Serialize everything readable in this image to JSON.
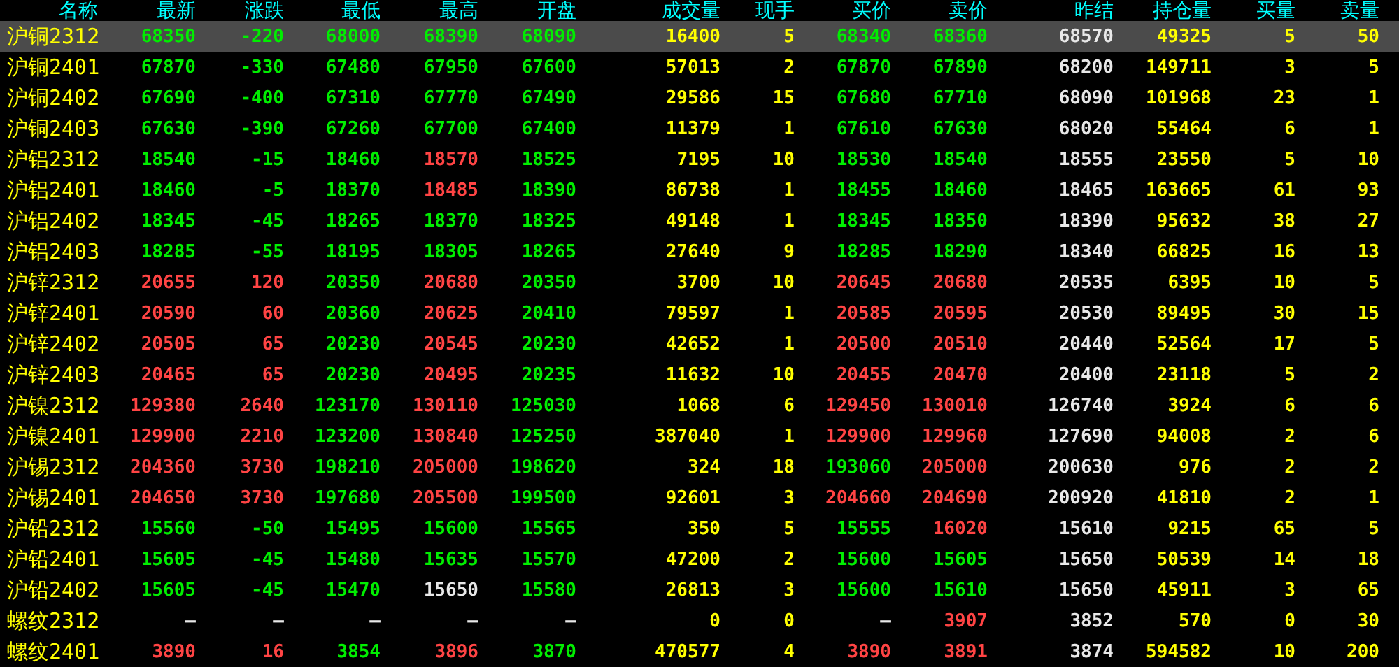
{
  "columns": [
    "名称",
    "最新",
    "涨跌",
    "最低",
    "最高",
    "开盘",
    "成交量",
    "现手",
    "买价",
    "卖价",
    "昨结",
    "持仓量",
    "买量",
    "卖量"
  ],
  "rows": [
    {
      "name": "沪铜2312",
      "selected": true,
      "last": {
        "text": "68350",
        "color": "#00ee00"
      },
      "change": {
        "text": "-220",
        "color": "#00ee00"
      },
      "low": {
        "text": "68000",
        "color": "#00ee00"
      },
      "high": {
        "text": "68390",
        "color": "#00ee00"
      },
      "open": {
        "text": "68090",
        "color": "#00ee00"
      },
      "volume": "16400",
      "hand": "5",
      "bid": {
        "text": "68340",
        "color": "#00ee00"
      },
      "ask": {
        "text": "68360",
        "color": "#00ee00"
      },
      "prev_settle": "68570",
      "open_interest": "49325",
      "bid_qty": "5",
      "ask_qty": "50"
    },
    {
      "name": "沪铜2401",
      "selected": false,
      "last": {
        "text": "67870",
        "color": "#00ee00"
      },
      "change": {
        "text": "-330",
        "color": "#00ee00"
      },
      "low": {
        "text": "67480",
        "color": "#00ee00"
      },
      "high": {
        "text": "67950",
        "color": "#00ee00"
      },
      "open": {
        "text": "67600",
        "color": "#00ee00"
      },
      "volume": "57013",
      "hand": "2",
      "bid": {
        "text": "67870",
        "color": "#00ee00"
      },
      "ask": {
        "text": "67890",
        "color": "#00ee00"
      },
      "prev_settle": "68200",
      "open_interest": "149711",
      "bid_qty": "3",
      "ask_qty": "5"
    },
    {
      "name": "沪铜2402",
      "selected": false,
      "last": {
        "text": "67690",
        "color": "#00ee00"
      },
      "change": {
        "text": "-400",
        "color": "#00ee00"
      },
      "low": {
        "text": "67310",
        "color": "#00ee00"
      },
      "high": {
        "text": "67770",
        "color": "#00ee00"
      },
      "open": {
        "text": "67490",
        "color": "#00ee00"
      },
      "volume": "29586",
      "hand": "15",
      "bid": {
        "text": "67680",
        "color": "#00ee00"
      },
      "ask": {
        "text": "67710",
        "color": "#00ee00"
      },
      "prev_settle": "68090",
      "open_interest": "101968",
      "bid_qty": "23",
      "ask_qty": "1"
    },
    {
      "name": "沪铜2403",
      "selected": false,
      "last": {
        "text": "67630",
        "color": "#00ee00"
      },
      "change": {
        "text": "-390",
        "color": "#00ee00"
      },
      "low": {
        "text": "67260",
        "color": "#00ee00"
      },
      "high": {
        "text": "67700",
        "color": "#00ee00"
      },
      "open": {
        "text": "67400",
        "color": "#00ee00"
      },
      "volume": "11379",
      "hand": "1",
      "bid": {
        "text": "67610",
        "color": "#00ee00"
      },
      "ask": {
        "text": "67630",
        "color": "#00ee00"
      },
      "prev_settle": "68020",
      "open_interest": "55464",
      "bid_qty": "6",
      "ask_qty": "1"
    },
    {
      "name": "沪铝2312",
      "selected": false,
      "last": {
        "text": "18540",
        "color": "#00ee00"
      },
      "change": {
        "text": "-15",
        "color": "#00ee00"
      },
      "low": {
        "text": "18460",
        "color": "#00ee00"
      },
      "high": {
        "text": "18570",
        "color": "#ff4444"
      },
      "open": {
        "text": "18525",
        "color": "#00ee00"
      },
      "volume": "7195",
      "hand": "10",
      "bid": {
        "text": "18530",
        "color": "#00ee00"
      },
      "ask": {
        "text": "18540",
        "color": "#00ee00"
      },
      "prev_settle": "18555",
      "open_interest": "23550",
      "bid_qty": "5",
      "ask_qty": "10"
    },
    {
      "name": "沪铝2401",
      "selected": false,
      "last": {
        "text": "18460",
        "color": "#00ee00"
      },
      "change": {
        "text": "-5",
        "color": "#00ee00"
      },
      "low": {
        "text": "18370",
        "color": "#00ee00"
      },
      "high": {
        "text": "18485",
        "color": "#ff4444"
      },
      "open": {
        "text": "18390",
        "color": "#00ee00"
      },
      "volume": "86738",
      "hand": "1",
      "bid": {
        "text": "18455",
        "color": "#00ee00"
      },
      "ask": {
        "text": "18460",
        "color": "#00ee00"
      },
      "prev_settle": "18465",
      "open_interest": "163665",
      "bid_qty": "61",
      "ask_qty": "93"
    },
    {
      "name": "沪铝2402",
      "selected": false,
      "last": {
        "text": "18345",
        "color": "#00ee00"
      },
      "change": {
        "text": "-45",
        "color": "#00ee00"
      },
      "low": {
        "text": "18265",
        "color": "#00ee00"
      },
      "high": {
        "text": "18370",
        "color": "#00ee00"
      },
      "open": {
        "text": "18325",
        "color": "#00ee00"
      },
      "volume": "49148",
      "hand": "1",
      "bid": {
        "text": "18345",
        "color": "#00ee00"
      },
      "ask": {
        "text": "18350",
        "color": "#00ee00"
      },
      "prev_settle": "18390",
      "open_interest": "95632",
      "bid_qty": "38",
      "ask_qty": "27"
    },
    {
      "name": "沪铝2403",
      "selected": false,
      "last": {
        "text": "18285",
        "color": "#00ee00"
      },
      "change": {
        "text": "-55",
        "color": "#00ee00"
      },
      "low": {
        "text": "18195",
        "color": "#00ee00"
      },
      "high": {
        "text": "18305",
        "color": "#00ee00"
      },
      "open": {
        "text": "18265",
        "color": "#00ee00"
      },
      "volume": "27640",
      "hand": "9",
      "bid": {
        "text": "18285",
        "color": "#00ee00"
      },
      "ask": {
        "text": "18290",
        "color": "#00ee00"
      },
      "prev_settle": "18340",
      "open_interest": "66825",
      "bid_qty": "16",
      "ask_qty": "13"
    },
    {
      "name": "沪锌2312",
      "selected": false,
      "last": {
        "text": "20655",
        "color": "#ff4444"
      },
      "change": {
        "text": "120",
        "color": "#ff4444"
      },
      "low": {
        "text": "20350",
        "color": "#00ee00"
      },
      "high": {
        "text": "20680",
        "color": "#ff4444"
      },
      "open": {
        "text": "20350",
        "color": "#00ee00"
      },
      "volume": "3700",
      "hand": "10",
      "bid": {
        "text": "20645",
        "color": "#ff4444"
      },
      "ask": {
        "text": "20680",
        "color": "#ff4444"
      },
      "prev_settle": "20535",
      "open_interest": "6395",
      "bid_qty": "10",
      "ask_qty": "5"
    },
    {
      "name": "沪锌2401",
      "selected": false,
      "last": {
        "text": "20590",
        "color": "#ff4444"
      },
      "change": {
        "text": "60",
        "color": "#ff4444"
      },
      "low": {
        "text": "20360",
        "color": "#00ee00"
      },
      "high": {
        "text": "20625",
        "color": "#ff4444"
      },
      "open": {
        "text": "20410",
        "color": "#00ee00"
      },
      "volume": "79597",
      "hand": "1",
      "bid": {
        "text": "20585",
        "color": "#ff4444"
      },
      "ask": {
        "text": "20595",
        "color": "#ff4444"
      },
      "prev_settle": "20530",
      "open_interest": "89495",
      "bid_qty": "30",
      "ask_qty": "15"
    },
    {
      "name": "沪锌2402",
      "selected": false,
      "last": {
        "text": "20505",
        "color": "#ff4444"
      },
      "change": {
        "text": "65",
        "color": "#ff4444"
      },
      "low": {
        "text": "20230",
        "color": "#00ee00"
      },
      "high": {
        "text": "20545",
        "color": "#ff4444"
      },
      "open": {
        "text": "20230",
        "color": "#00ee00"
      },
      "volume": "42652",
      "hand": "1",
      "bid": {
        "text": "20500",
        "color": "#ff4444"
      },
      "ask": {
        "text": "20510",
        "color": "#ff4444"
      },
      "prev_settle": "20440",
      "open_interest": "52564",
      "bid_qty": "17",
      "ask_qty": "5"
    },
    {
      "name": "沪锌2403",
      "selected": false,
      "last": {
        "text": "20465",
        "color": "#ff4444"
      },
      "change": {
        "text": "65",
        "color": "#ff4444"
      },
      "low": {
        "text": "20230",
        "color": "#00ee00"
      },
      "high": {
        "text": "20495",
        "color": "#ff4444"
      },
      "open": {
        "text": "20235",
        "color": "#00ee00"
      },
      "volume": "11632",
      "hand": "10",
      "bid": {
        "text": "20455",
        "color": "#ff4444"
      },
      "ask": {
        "text": "20470",
        "color": "#ff4444"
      },
      "prev_settle": "20400",
      "open_interest": "23118",
      "bid_qty": "5",
      "ask_qty": "2"
    },
    {
      "name": "沪镍2312",
      "selected": false,
      "last": {
        "text": "129380",
        "color": "#ff4444"
      },
      "change": {
        "text": "2640",
        "color": "#ff4444"
      },
      "low": {
        "text": "123170",
        "color": "#00ee00"
      },
      "high": {
        "text": "130110",
        "color": "#ff4444"
      },
      "open": {
        "text": "125030",
        "color": "#00ee00"
      },
      "volume": "1068",
      "hand": "6",
      "bid": {
        "text": "129450",
        "color": "#ff4444"
      },
      "ask": {
        "text": "130010",
        "color": "#ff4444"
      },
      "prev_settle": "126740",
      "open_interest": "3924",
      "bid_qty": "6",
      "ask_qty": "6"
    },
    {
      "name": "沪镍2401",
      "selected": false,
      "last": {
        "text": "129900",
        "color": "#ff4444"
      },
      "change": {
        "text": "2210",
        "color": "#ff4444"
      },
      "low": {
        "text": "123200",
        "color": "#00ee00"
      },
      "high": {
        "text": "130840",
        "color": "#ff4444"
      },
      "open": {
        "text": "125250",
        "color": "#00ee00"
      },
      "volume": "387040",
      "hand": "1",
      "bid": {
        "text": "129900",
        "color": "#ff4444"
      },
      "ask": {
        "text": "129960",
        "color": "#ff4444"
      },
      "prev_settle": "127690",
      "open_interest": "94008",
      "bid_qty": "2",
      "ask_qty": "6"
    },
    {
      "name": "沪锡2312",
      "selected": false,
      "last": {
        "text": "204360",
        "color": "#ff4444"
      },
      "change": {
        "text": "3730",
        "color": "#ff4444"
      },
      "low": {
        "text": "198210",
        "color": "#00ee00"
      },
      "high": {
        "text": "205000",
        "color": "#ff4444"
      },
      "open": {
        "text": "198620",
        "color": "#00ee00"
      },
      "volume": "324",
      "hand": "18",
      "bid": {
        "text": "193060",
        "color": "#00ee00"
      },
      "ask": {
        "text": "205000",
        "color": "#ff4444"
      },
      "prev_settle": "200630",
      "open_interest": "976",
      "bid_qty": "2",
      "ask_qty": "2"
    },
    {
      "name": "沪锡2401",
      "selected": false,
      "last": {
        "text": "204650",
        "color": "#ff4444"
      },
      "change": {
        "text": "3730",
        "color": "#ff4444"
      },
      "low": {
        "text": "197680",
        "color": "#00ee00"
      },
      "high": {
        "text": "205500",
        "color": "#ff4444"
      },
      "open": {
        "text": "199500",
        "color": "#00ee00"
      },
      "volume": "92601",
      "hand": "3",
      "bid": {
        "text": "204660",
        "color": "#ff4444"
      },
      "ask": {
        "text": "204690",
        "color": "#ff4444"
      },
      "prev_settle": "200920",
      "open_interest": "41810",
      "bid_qty": "2",
      "ask_qty": "1"
    },
    {
      "name": "沪铅2312",
      "selected": false,
      "last": {
        "text": "15560",
        "color": "#00ee00"
      },
      "change": {
        "text": "-50",
        "color": "#00ee00"
      },
      "low": {
        "text": "15495",
        "color": "#00ee00"
      },
      "high": {
        "text": "15600",
        "color": "#00ee00"
      },
      "open": {
        "text": "15565",
        "color": "#00ee00"
      },
      "volume": "350",
      "hand": "5",
      "bid": {
        "text": "15555",
        "color": "#00ee00"
      },
      "ask": {
        "text": "16020",
        "color": "#ff4444"
      },
      "prev_settle": "15610",
      "open_interest": "9215",
      "bid_qty": "65",
      "ask_qty": "5"
    },
    {
      "name": "沪铅2401",
      "selected": false,
      "last": {
        "text": "15605",
        "color": "#00ee00"
      },
      "change": {
        "text": "-45",
        "color": "#00ee00"
      },
      "low": {
        "text": "15480",
        "color": "#00ee00"
      },
      "high": {
        "text": "15635",
        "color": "#00ee00"
      },
      "open": {
        "text": "15570",
        "color": "#00ee00"
      },
      "volume": "47200",
      "hand": "2",
      "bid": {
        "text": "15600",
        "color": "#00ee00"
      },
      "ask": {
        "text": "15605",
        "color": "#00ee00"
      },
      "prev_settle": "15650",
      "open_interest": "50539",
      "bid_qty": "14",
      "ask_qty": "18"
    },
    {
      "name": "沪铅2402",
      "selected": false,
      "last": {
        "text": "15605",
        "color": "#00ee00"
      },
      "change": {
        "text": "-45",
        "color": "#00ee00"
      },
      "low": {
        "text": "15470",
        "color": "#00ee00"
      },
      "high": {
        "text": "15650",
        "color": "#e8e8e8"
      },
      "open": {
        "text": "15580",
        "color": "#00ee00"
      },
      "volume": "26813",
      "hand": "3",
      "bid": {
        "text": "15600",
        "color": "#00ee00"
      },
      "ask": {
        "text": "15610",
        "color": "#00ee00"
      },
      "prev_settle": "15650",
      "open_interest": "45911",
      "bid_qty": "3",
      "ask_qty": "65"
    },
    {
      "name": "螺纹2312",
      "selected": false,
      "last": {
        "text": "—",
        "color": "#e8e8e8"
      },
      "change": {
        "text": "—",
        "color": "#e8e8e8"
      },
      "low": {
        "text": "—",
        "color": "#e8e8e8"
      },
      "high": {
        "text": "—",
        "color": "#e8e8e8"
      },
      "open": {
        "text": "—",
        "color": "#e8e8e8"
      },
      "volume": "0",
      "hand": "0",
      "bid": {
        "text": "—",
        "color": "#e8e8e8"
      },
      "ask": {
        "text": "3907",
        "color": "#ff4444"
      },
      "prev_settle": "3852",
      "open_interest": "570",
      "bid_qty": "0",
      "ask_qty": "30"
    },
    {
      "name": "螺纹2401",
      "selected": false,
      "last": {
        "text": "3890",
        "color": "#ff4444"
      },
      "change": {
        "text": "16",
        "color": "#ff4444"
      },
      "low": {
        "text": "3854",
        "color": "#00ee00"
      },
      "high": {
        "text": "3896",
        "color": "#ff4444"
      },
      "open": {
        "text": "3870",
        "color": "#00ee00"
      },
      "volume": "470577",
      "hand": "4",
      "bid": {
        "text": "3890",
        "color": "#ff4444"
      },
      "ask": {
        "text": "3891",
        "color": "#ff4444"
      },
      "prev_settle": "3874",
      "open_interest": "594582",
      "bid_qty": "10",
      "ask_qty": "200"
    }
  ]
}
